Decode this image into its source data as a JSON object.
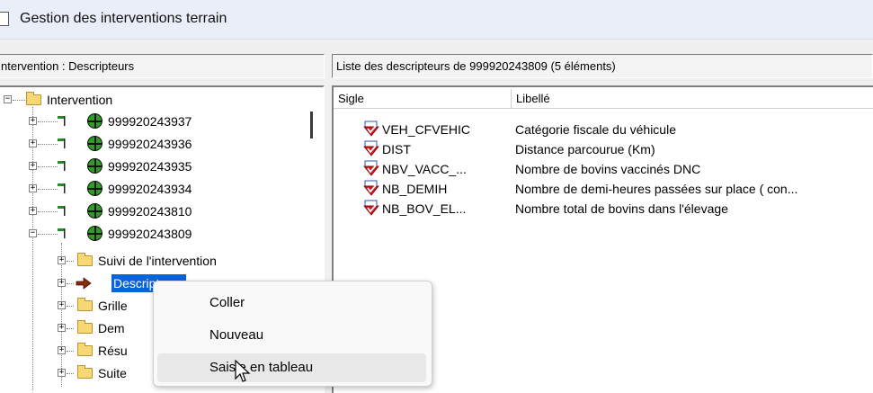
{
  "window": {
    "title": "Gestion des interventions terrain"
  },
  "left_panel": {
    "header": "ntervention : Descripteurs",
    "tree": {
      "root_label": "Intervention",
      "interventions": [
        "999920243937",
        "999920243936",
        "999920243935",
        "999920243934",
        "999920243810",
        "999920243809"
      ],
      "children": [
        "Suivi de l'intervention",
        "Descripteurs",
        "Grille",
        "Dem",
        "Résu",
        "Suite"
      ]
    }
  },
  "right_panel": {
    "header": "Liste des descripteurs de  999920243809 (5 éléments)",
    "columns": {
      "sigle": "Sigle",
      "libelle": "Libellé"
    },
    "rows": [
      {
        "sigle": "VEH_CFVEHIC",
        "libelle": "Catégorie fiscale du véhicule"
      },
      {
        "sigle": "DIST",
        "libelle": "Distance parcourue (Km)"
      },
      {
        "sigle": "NBV_VACC_...",
        "libelle": "Nombre de bovins vaccinés DNC"
      },
      {
        "sigle": "NB_DEMIH",
        "libelle": "Nombre de demi-heures passées sur place ( con..."
      },
      {
        "sigle": "NB_BOV_EL...",
        "libelle": "Nombre total de bovins dans l'élevage"
      }
    ]
  },
  "context_menu": {
    "items": [
      "Coller",
      "Nouveau",
      "Saisie en tableau"
    ],
    "hovered_index": 2
  },
  "icons": {
    "folder": "folder-icon",
    "intervention": "globe-icon",
    "descriptor": "descriptor-icon",
    "selected_node": "arrow-right-icon",
    "cursor": "mouse-cursor-icon"
  },
  "colors": {
    "selection": "#0a64d8",
    "globe": "#2d9e23",
    "folder": "#f8d775"
  }
}
